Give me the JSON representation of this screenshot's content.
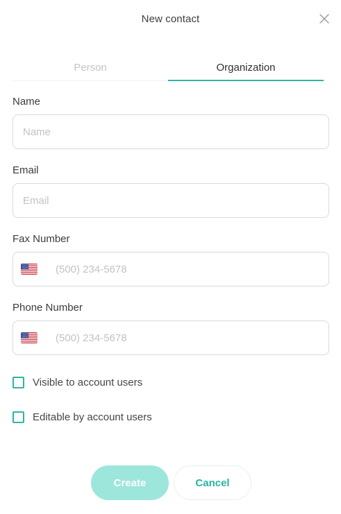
{
  "dialog": {
    "title": "New contact"
  },
  "tabs": [
    {
      "label": "Person",
      "active": false
    },
    {
      "label": "Organization",
      "active": true
    }
  ],
  "form": {
    "name": {
      "label": "Name",
      "placeholder": "Name",
      "value": ""
    },
    "email": {
      "label": "Email",
      "placeholder": "Email",
      "value": ""
    },
    "fax": {
      "label": "Fax Number",
      "placeholder": "(500) 234-5678",
      "value": "",
      "country_flag": "us-flag-icon"
    },
    "phone": {
      "label": "Phone Number",
      "placeholder": "(500) 234-5678",
      "value": "",
      "country_flag": "us-flag-icon"
    }
  },
  "options": {
    "visible": {
      "label": "Visible to account users",
      "checked": false
    },
    "editable": {
      "label": "Editable by account users",
      "checked": false
    }
  },
  "actions": {
    "create_label": "Create",
    "cancel_label": "Cancel"
  },
  "colors": {
    "accent": "#2bb5a3",
    "create_button_bg": "#9de6dc",
    "input_border": "#d9d9d9",
    "placeholder": "#c2c2c2"
  }
}
